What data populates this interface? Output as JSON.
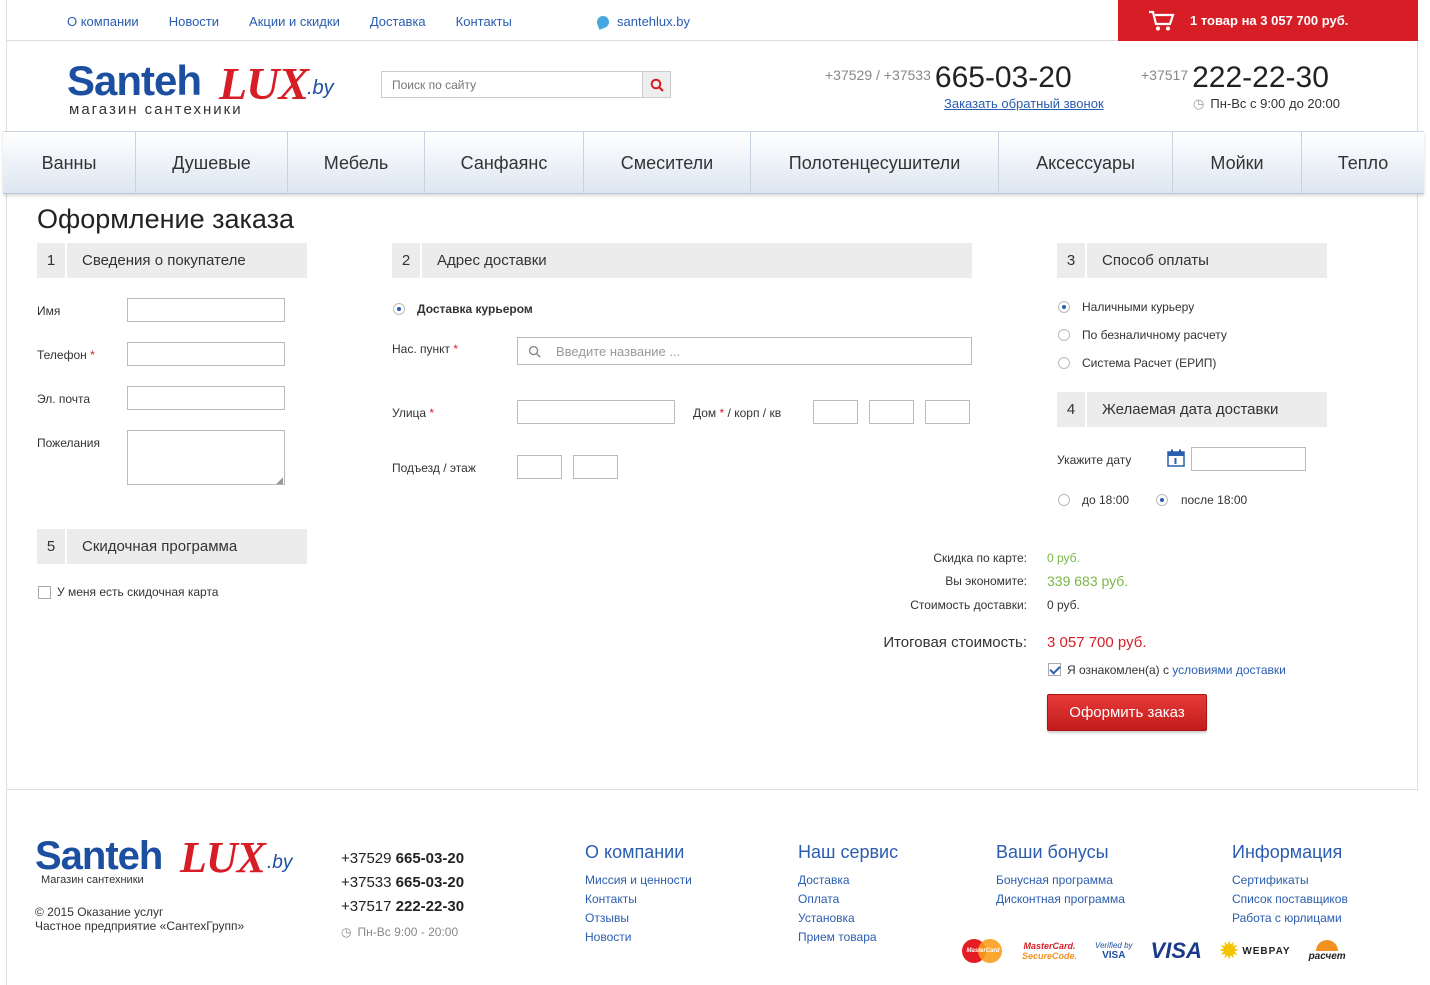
{
  "topnav": [
    "О компании",
    "Новости",
    "Акции и скидки",
    "Доставка",
    "Контакты"
  ],
  "skype": "santehlux.by",
  "cart": "1 товар на 3 057 700 руб.",
  "logo": {
    "w1": "Santeh",
    "w2": "LUX",
    "w3": ".by",
    "sub": "магазин сантехники"
  },
  "search": {
    "placeholder": "Поиск по сайту"
  },
  "phone1": {
    "prefix": "+37529 / +37533",
    "number": "665-03-20"
  },
  "callback": "Заказать обратный звонок",
  "phone2": {
    "prefix": "+37517",
    "number": "222-22-30"
  },
  "hours": "Пн-Вс с 9:00 до 20:00",
  "menu": [
    "Ванны",
    "Душевые",
    "Мебель",
    "Санфаянс",
    "Смесители",
    "Полотенцесушители",
    "Аксессуары",
    "Мойки",
    "Тепло"
  ],
  "title": "Оформление заказа",
  "sections": {
    "s1": {
      "num": "1",
      "title": "Сведения о покупателе"
    },
    "s2": {
      "num": "2",
      "title": "Адрес доставки"
    },
    "s3": {
      "num": "3",
      "title": "Способ оплаты"
    },
    "s4": {
      "num": "4",
      "title": "Желаемая дата доставки"
    },
    "s5": {
      "num": "5",
      "title": "Скидочная программа"
    }
  },
  "buyer": {
    "name": "Имя",
    "phone": "Телефон",
    "email": "Эл. почта",
    "wishes": "Пожелания"
  },
  "req": "*",
  "delivery": {
    "courier": "Доставка курьером",
    "city": "Нас. пункт",
    "city_placeholder": "Введите название ...",
    "street": "Улица",
    "house": "Дом",
    "house_rest": "/ корп / кв",
    "entrance": "Подъезд / этаж"
  },
  "payment": [
    "Наличными курьеру",
    "По безналичному расчету",
    "Система Расчет (ЕРИП)"
  ],
  "date": {
    "label": "Укажите дату",
    "before": "до 18:00",
    "after": "после 18:00"
  },
  "discount": {
    "card": "У меня есть скидочная карта"
  },
  "summary": {
    "card_label": "Скидка по карте:",
    "card_value": "0 руб.",
    "save_label": "Вы экономите:",
    "save_value": "339 683 руб.",
    "ship_label": "Стоимость доставки:",
    "ship_value": "0 руб.",
    "total_label": "Итоговая стоимость:",
    "total_value": "3 057 700 руб.",
    "agree": "Я ознакомлен(а) с",
    "agree_link": "условиями доставки"
  },
  "order_button": "Оформить заказ",
  "footer": {
    "logo_sub": "Магазин сантехники",
    "copy1": "© 2015 Оказание услуг",
    "copy2": "Частное предприятие «СантехГрупп»",
    "phones": [
      {
        "prefix": "+37529",
        "number": "665-03-20"
      },
      {
        "prefix": "+37533",
        "number": "665-03-20"
      },
      {
        "prefix": "+37517",
        "number": "222-22-30"
      }
    ],
    "hours": "Пн-Вс 9:00 - 20:00",
    "cols": [
      {
        "title": "О компании",
        "links": [
          "Миссия и ценности",
          "Контакты",
          "Отзывы",
          "Новости"
        ]
      },
      {
        "title": "Наш сервис",
        "links": [
          "Доставка",
          "Оплата",
          "Установка",
          "Прием товара"
        ]
      },
      {
        "title": "Ваши бонусы",
        "links": [
          "Бонусная программа",
          "Дисконтная программа"
        ]
      },
      {
        "title": "Информация",
        "links": [
          "Сертификаты",
          "Список поставщиков",
          "Работа с юрлицами"
        ]
      }
    ],
    "pay": {
      "mc": "MasterCard",
      "mcsc1": "MasterCard.",
      "mcsc2": "SecureCode.",
      "vbv1": "Verified by",
      "vbv2": "VISA",
      "visa": "VISA",
      "webpay": "WEBPAY",
      "raschet": "расчет"
    }
  },
  "colors": {
    "brand_red": "#d71e27",
    "brand_blue": "#1d4fa0",
    "link": "#2a5db0",
    "green": "#7ab648"
  }
}
